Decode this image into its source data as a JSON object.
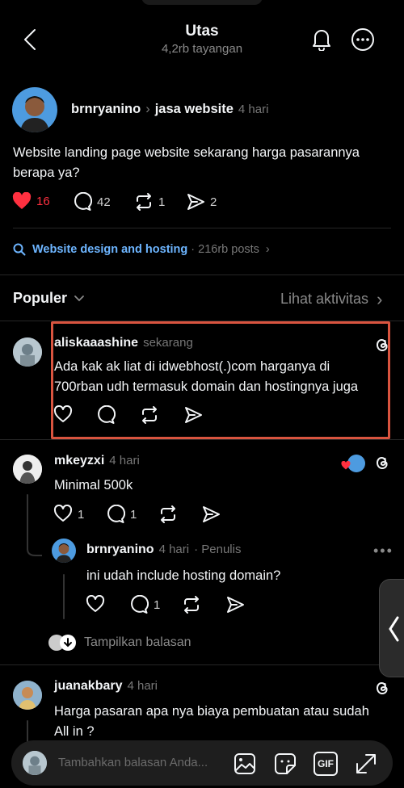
{
  "header": {
    "title": "Utas",
    "subtitle": "4,2rb tayangan"
  },
  "post": {
    "author": "brnryanino",
    "community": "jasa website",
    "time": "4 hari",
    "text": "Website landing page website sekarang harga pasarannya berapa ya?",
    "likes": "16",
    "comments": "42",
    "reposts": "1",
    "shares": "2"
  },
  "topic": {
    "label": "Website design and hosting",
    "meta": "· 216rb posts"
  },
  "sort": {
    "label": "Populer",
    "activity_link": "Lihat aktivitas"
  },
  "replies": [
    {
      "author": "aliskaaashine",
      "time": "sekarang",
      "text": "Ada kak ak liat di idwebhost(.)com harganya di 700rban udh termasuk domain dan hostingnya juga"
    },
    {
      "author": "mkeyzxi",
      "time": "4 hari",
      "text": "Minimal 500k",
      "likes": "1",
      "comments": "1"
    },
    {
      "author": "brnryanino",
      "time": "4 hari",
      "role": "· Penulis",
      "text": "ini udah include hosting domain?",
      "comments": "1"
    },
    {
      "author": "juanakbary",
      "time": "4 hari",
      "text": "Harga pasaran apa nya biaya pembuatan atau sudah All in ?"
    }
  ],
  "show_replies": "Tampilkan balasan",
  "compose": {
    "placeholder": "Tambahkan balasan Anda...",
    "gif_label": "GIF"
  },
  "colors": {
    "background": "#000000",
    "like_red": "#ff3040",
    "link_blue": "#6db5ff",
    "highlight_border": "#d9543f"
  }
}
